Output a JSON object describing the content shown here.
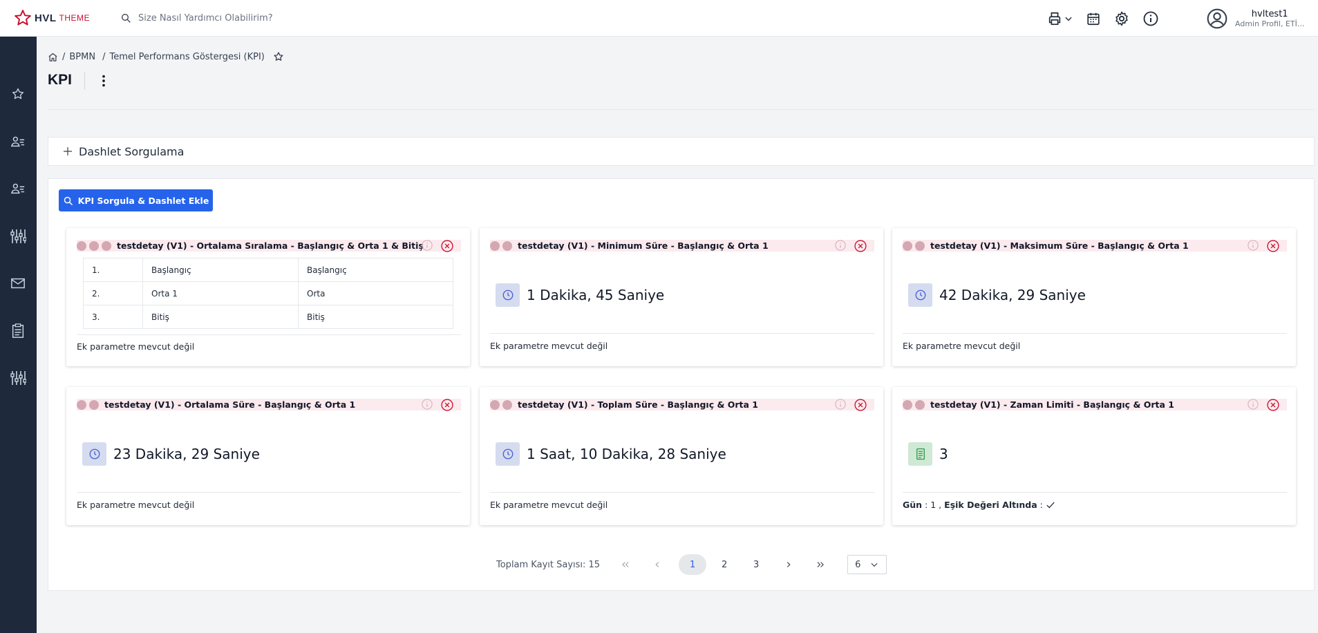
{
  "header": {
    "brand": "HVL",
    "brand_suffix": "THEME",
    "search_placeholder": "Size Nasıl Yardımcı Olabilirim?",
    "icons": [
      "printer-icon",
      "chevron-down-icon",
      "calendar-icon",
      "gear-icon",
      "info-icon"
    ],
    "user": {
      "name": "hvltest1",
      "role": "Admin Profil, ETİ..."
    }
  },
  "sidebar": {
    "items": [
      "star-icon",
      "users-icon",
      "users-icon",
      "sliders-icon",
      "mail-icon",
      "clipboard-icon",
      "sliders-icon"
    ]
  },
  "breadcrumb": {
    "items": [
      "BPMN",
      "Temel Performans Göstergesi (KPI)"
    ],
    "separator": "/"
  },
  "page": {
    "title": "KPI"
  },
  "dashlet_query": {
    "label": "Dashlet Sorgulama"
  },
  "main": {
    "kpi_button": "KPI Sorgula & Dashlet Ekle",
    "cards": [
      {
        "dot_count": 3,
        "title": "testdetay (V1) - Ortalama Sıralama - Başlangıç & Orta 1 & Bitiş",
        "table": [
          [
            "1.",
            "Başlangıç",
            "Başlangıç"
          ],
          [
            "2.",
            "Orta 1",
            "Orta"
          ],
          [
            "3.",
            "Bitiş",
            "Bitiş"
          ]
        ],
        "footer": "Ek parametre mevcut değil"
      },
      {
        "dot_count": 2,
        "title": "testdetay (V1) - Minimum Süre - Başlangıç & Orta 1",
        "icon": "clock-icon",
        "value": "1 Dakika, 45 Saniye",
        "footer": "Ek parametre mevcut değil"
      },
      {
        "dot_count": 2,
        "title": "testdetay (V1) - Maksimum Süre - Başlangıç & Orta 1",
        "icon": "clock-icon",
        "value": "42 Dakika, 29 Saniye",
        "footer": "Ek parametre mevcut değil"
      },
      {
        "dot_count": 2,
        "title": "testdetay (V1) - Ortalama Süre - Başlangıç & Orta 1",
        "icon": "clock-icon",
        "value": "23 Dakika, 29 Saniye",
        "footer": "Ek parametre mevcut değil"
      },
      {
        "dot_count": 2,
        "title": "testdetay (V1) - Toplam Süre - Başlangıç & Orta 1",
        "icon": "clock-icon",
        "value": "1 Saat, 10 Dakika, 28 Saniye",
        "footer": "Ek parametre mevcut değil"
      },
      {
        "dot_count": 2,
        "title": "testdetay (V1) - Zaman Limiti - Başlangıç & Orta 1",
        "icon": "document-icon",
        "value": "3",
        "footer_parts": {
          "gun_label": "Gün",
          "gun_value": ": 1 ,",
          "esik_label": "Eşik Değeri Altında",
          "esik_sep": ":"
        }
      }
    ]
  },
  "pagination": {
    "total_label": "Toplam Kayıt Sayısı: 15",
    "pages": [
      "1",
      "2",
      "3"
    ],
    "current": "1",
    "page_size": "6"
  },
  "colors": {
    "primary": "#2563eb",
    "sidebar": "#1e293b",
    "card_header": "#fbeaee",
    "close": "#c8102e"
  }
}
